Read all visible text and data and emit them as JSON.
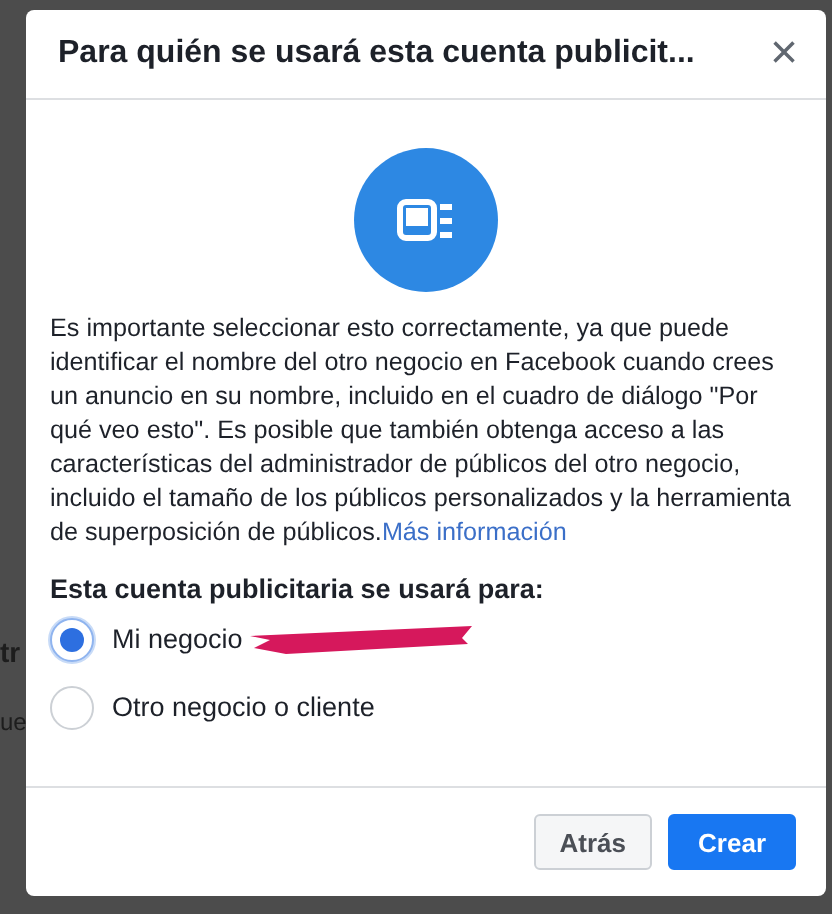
{
  "backdrop": {
    "fragments": [
      "tr",
      "ue"
    ]
  },
  "dialog": {
    "title": "Para quién se usará esta cuenta publicit...",
    "close": "×",
    "body": "Es importante seleccionar esto correctamente, ya que puede identificar el nombre del otro negocio en Facebook cuando crees un anuncio en su nombre, incluido en el cuadro de diálogo \"Por qué veo esto\". Es posible que también obtenga acceso a las características del administrador de públicos del otro negocio, incluido el tamaño de los públicos personalizados y la herramienta de superposición de públicos.",
    "link": "Más información",
    "question": "Esta cuenta publicitaria se usará para:",
    "options": [
      {
        "label": "Mi negocio",
        "selected": true,
        "redacted": true
      },
      {
        "label": "Otro negocio o cliente",
        "selected": false,
        "redacted": false
      }
    ],
    "buttons": [
      {
        "label": "Atrás",
        "kind": "secondary"
      },
      {
        "label": "Crear",
        "kind": "primary"
      }
    ]
  }
}
